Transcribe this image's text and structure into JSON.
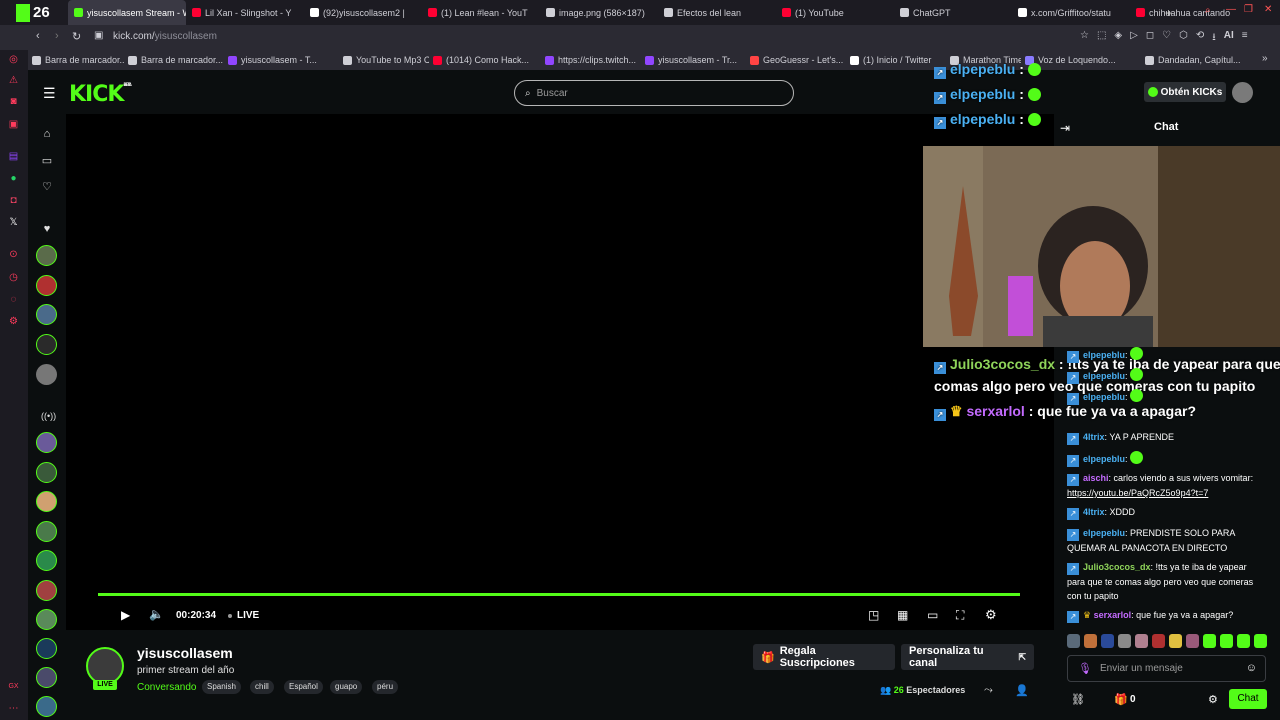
{
  "browser": {
    "tabs": [
      {
        "title": "yisuscollasem Stream - W",
        "color": "#53fc18",
        "active": true
      },
      {
        "title": "Lil Xan - Slingshot - Y",
        "color": "#ff0033"
      },
      {
        "title": "(92)yisuscollasem2 |",
        "color": "#ffffff"
      },
      {
        "title": "(1) Lean #lean - YouT",
        "color": "#ff0033"
      },
      {
        "title": "image.png (586×187)",
        "color": "#cfcfd6"
      },
      {
        "title": "Efectos del lean",
        "color": "#cfcfd6"
      },
      {
        "title": "(1) YouTube",
        "color": "#ff0033"
      },
      {
        "title": "ChatGPT",
        "color": "#cfcfd6"
      },
      {
        "title": "x.com/Griffitoo/statu",
        "color": "#ffffff"
      },
      {
        "title": "chihuahua cantando",
        "color": "#ff0033"
      }
    ],
    "tab_counter": "26",
    "url_prefix": "kick.com/",
    "url_path": "yisuscollasem",
    "ai_label": "AI",
    "bookmarks": [
      {
        "label": "Barra de marcador...",
        "color": "#cfcfd6"
      },
      {
        "label": "Barra de marcador...",
        "color": "#cfcfd6"
      },
      {
        "label": "yisuscollasem - T...",
        "color": "#9146ff"
      },
      {
        "label": "YouTube to Mp3 C...",
        "color": "#cfcfd6"
      },
      {
        "label": "(1014) Como Hack...",
        "color": "#ff0033"
      },
      {
        "label": "https://clips.twitch...",
        "color": "#9146ff"
      },
      {
        "label": "yisuscollasem - Tr...",
        "color": "#9146ff"
      },
      {
        "label": "GeoGuessr - Let's...",
        "color": "#ff4444"
      },
      {
        "label": "(1) Inicio / Twitter",
        "color": "#ffffff"
      },
      {
        "label": "Marathon Timer",
        "color": "#cfcfd6"
      },
      {
        "label": "Voz de Loquendo...",
        "color": "#8a7bff"
      },
      {
        "label": "Dandadan, Capítul...",
        "color": "#cfcfd6"
      }
    ]
  },
  "kick": {
    "logo": "KICK",
    "logo_sup": "BETA",
    "search_placeholder": "Buscar",
    "get_kicks": "Obtén KICKs",
    "chat_title": "Chat"
  },
  "player": {
    "time": "00:20:34",
    "live": "LIVE",
    "progress_fraction": 1.0
  },
  "channel": {
    "name": "yisuscollasem",
    "title": "primer stream del año",
    "category": "Conversando",
    "live_badge": "LIVE",
    "tags": [
      "Spanish",
      "chill",
      "Español",
      "guapo",
      "péru"
    ],
    "gift_button": "Regala Suscripciones",
    "customize_button": "Personaliza tu canal",
    "viewers_count": "26",
    "viewers_label": "Espectadores"
  },
  "overlay": {
    "top_messages": [
      {
        "user": "elpepeblu",
        "sep": " :"
      },
      {
        "user": "elpepeblu",
        "sep": " :"
      },
      {
        "user": "elpepeblu",
        "sep": " :"
      }
    ],
    "messages": [
      {
        "user": "Julio3cocos_dx",
        "text": " : !tts ya te iba de yapear para que"
      },
      {
        "text": "comas algo pero veo que comeras con tu papito"
      },
      {
        "user": "serxarlol",
        "text": " : que fue ya va a apagar?"
      }
    ]
  },
  "chat": {
    "messages": [
      {
        "user": "elpepeblu",
        "text": ":",
        "color": "#4ab0f2"
      },
      {
        "user": "elpepeblu",
        "text": ":",
        "color": "#4ab0f2"
      },
      {
        "user": "elpepeblu",
        "text": ":",
        "color": "#4ab0f2"
      },
      {
        "user": "4ltrix",
        "text": ": YA P APRENDE",
        "color": "#4ab0f2"
      },
      {
        "user": "elpepeblu",
        "text": ":",
        "color": "#4ab0f2"
      },
      {
        "user": "aischi",
        "text": ": carlos viendo a sus wivers vomitar:",
        "color": "#c46bff",
        "link": "https://youtu.be/PaQRcZ5o9p4?t=7"
      },
      {
        "user": "4ltrix",
        "text": ": XDDD",
        "color": "#4ab0f2"
      },
      {
        "user": "elpepeblu",
        "text": ": PRENDISTE SOLO PARA QUEMAR AL PANACOTA EN DIRECTO",
        "color": "#4ab0f2"
      },
      {
        "user": "Julio3cocos_dx",
        "text": ": !tts ya te iba de yapear para que te comas algo pero veo que comeras con tu papito",
        "color": "#8fd45a"
      },
      {
        "user": "serxarlol",
        "text": ": que fue ya va a apagar?",
        "color": "#c46bff"
      }
    ],
    "input_placeholder": "Enviar un mensaje",
    "kicks_count": "0",
    "send_button": "Chat"
  }
}
